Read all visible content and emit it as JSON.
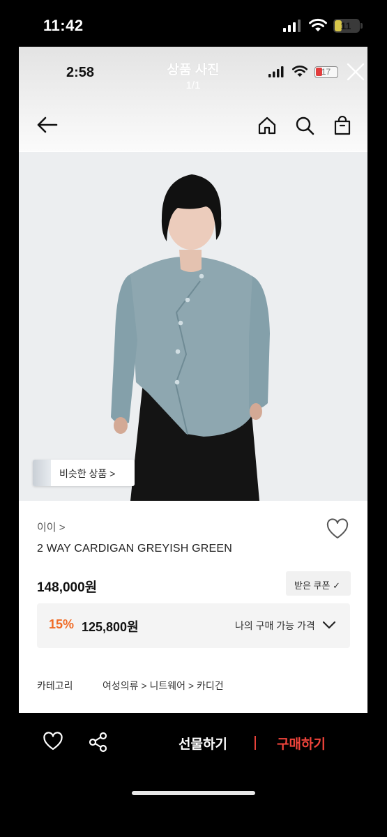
{
  "outer_status": {
    "time": "11:42",
    "battery": "11"
  },
  "inner_status": {
    "time": "2:58",
    "battery": "17"
  },
  "viewer": {
    "title": "상품 사진",
    "counter": "1/1"
  },
  "similar_button": {
    "label": "비슷한 상품 >"
  },
  "product": {
    "brand": "이이 >",
    "name": "2 WAY CARDIGAN GREYISH GREEN",
    "price": "148,000원",
    "coupon_label": "받은 쿠폰 ✓",
    "discount_rate": "15%",
    "discount_price": "125,800원",
    "my_price_label": "나의 구매 가능 가격"
  },
  "category": {
    "label": "카테고리",
    "path": "여성의류 > 니트웨어 > 카디건"
  },
  "bottom_bar": {
    "gift_label": "선물하기",
    "buy_label": "구매하기"
  },
  "colors": {
    "accent_orange": "#f06a24",
    "buy_red": "#f0443b",
    "photo_bg": "#eceef0"
  }
}
